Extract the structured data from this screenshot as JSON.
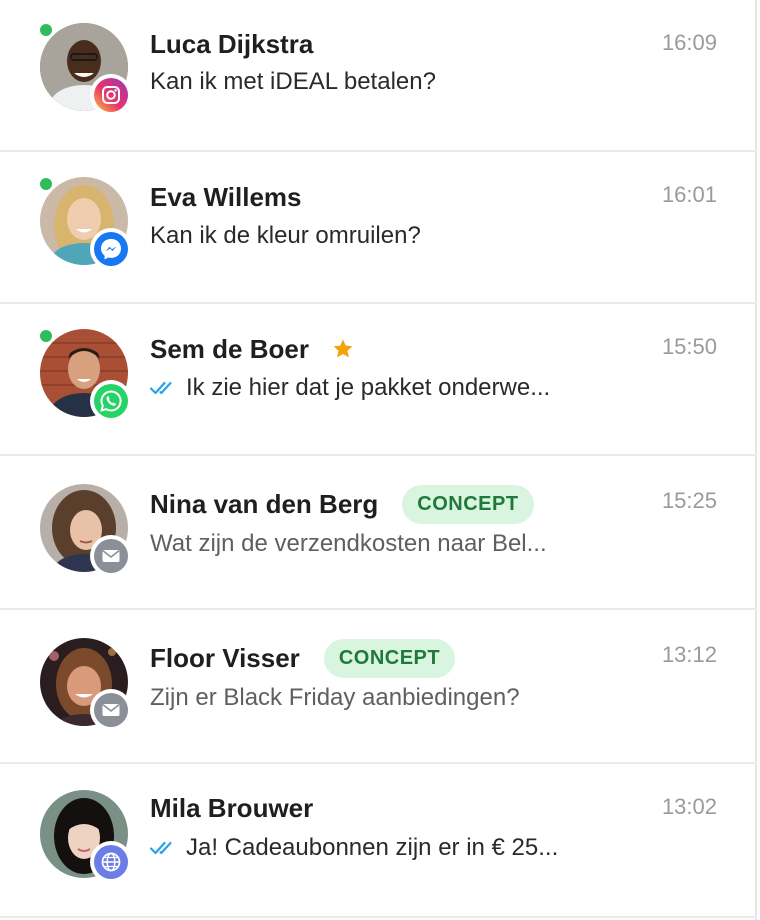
{
  "conversations": [
    {
      "name": "Luca Dijkstra",
      "time": "16:09",
      "preview": "Kan ik met iDEAL betalen?",
      "channel": "instagram-icon",
      "online": true,
      "starred": false,
      "badge": "",
      "read_ticks": false
    },
    {
      "name": "Eva Willems",
      "time": "16:01",
      "preview": "Kan ik de kleur omruilen?",
      "channel": "messenger-icon",
      "online": true,
      "starred": false,
      "badge": "",
      "read_ticks": false
    },
    {
      "name": "Sem de Boer",
      "time": "15:50",
      "preview": "Ik zie hier dat je pakket onderwe...",
      "channel": "whatsapp-icon",
      "online": true,
      "starred": true,
      "badge": "",
      "read_ticks": true
    },
    {
      "name": "Nina van den Berg",
      "time": "15:25",
      "preview": "Wat zijn de verzendkosten naar Bel...",
      "channel": "email-icon",
      "online": false,
      "starred": false,
      "badge": "CONCEPT",
      "read_ticks": false
    },
    {
      "name": "Floor Visser",
      "time": "13:12",
      "preview": "Zijn er Black Friday aanbiedingen?",
      "channel": "email-icon",
      "online": false,
      "starred": false,
      "badge": "CONCEPT",
      "read_ticks": false
    },
    {
      "name": "Mila Brouwer",
      "time": "13:02",
      "preview": "Ja! Cadeaubonnen zijn er in € 25...",
      "channel": "web-chat-icon",
      "online": false,
      "starred": false,
      "badge": "",
      "read_ticks": true
    }
  ],
  "colors": {
    "online": "#2ebd59",
    "badge_bg": "#d9f5e0",
    "badge_text": "#1f7a3a",
    "star": "#f5a30a",
    "read_ticks": "#29a3e8",
    "whatsapp": "#25d366",
    "messenger": "#1877f2",
    "email": "#8a8f98",
    "web_chat": "#6b7de6"
  }
}
